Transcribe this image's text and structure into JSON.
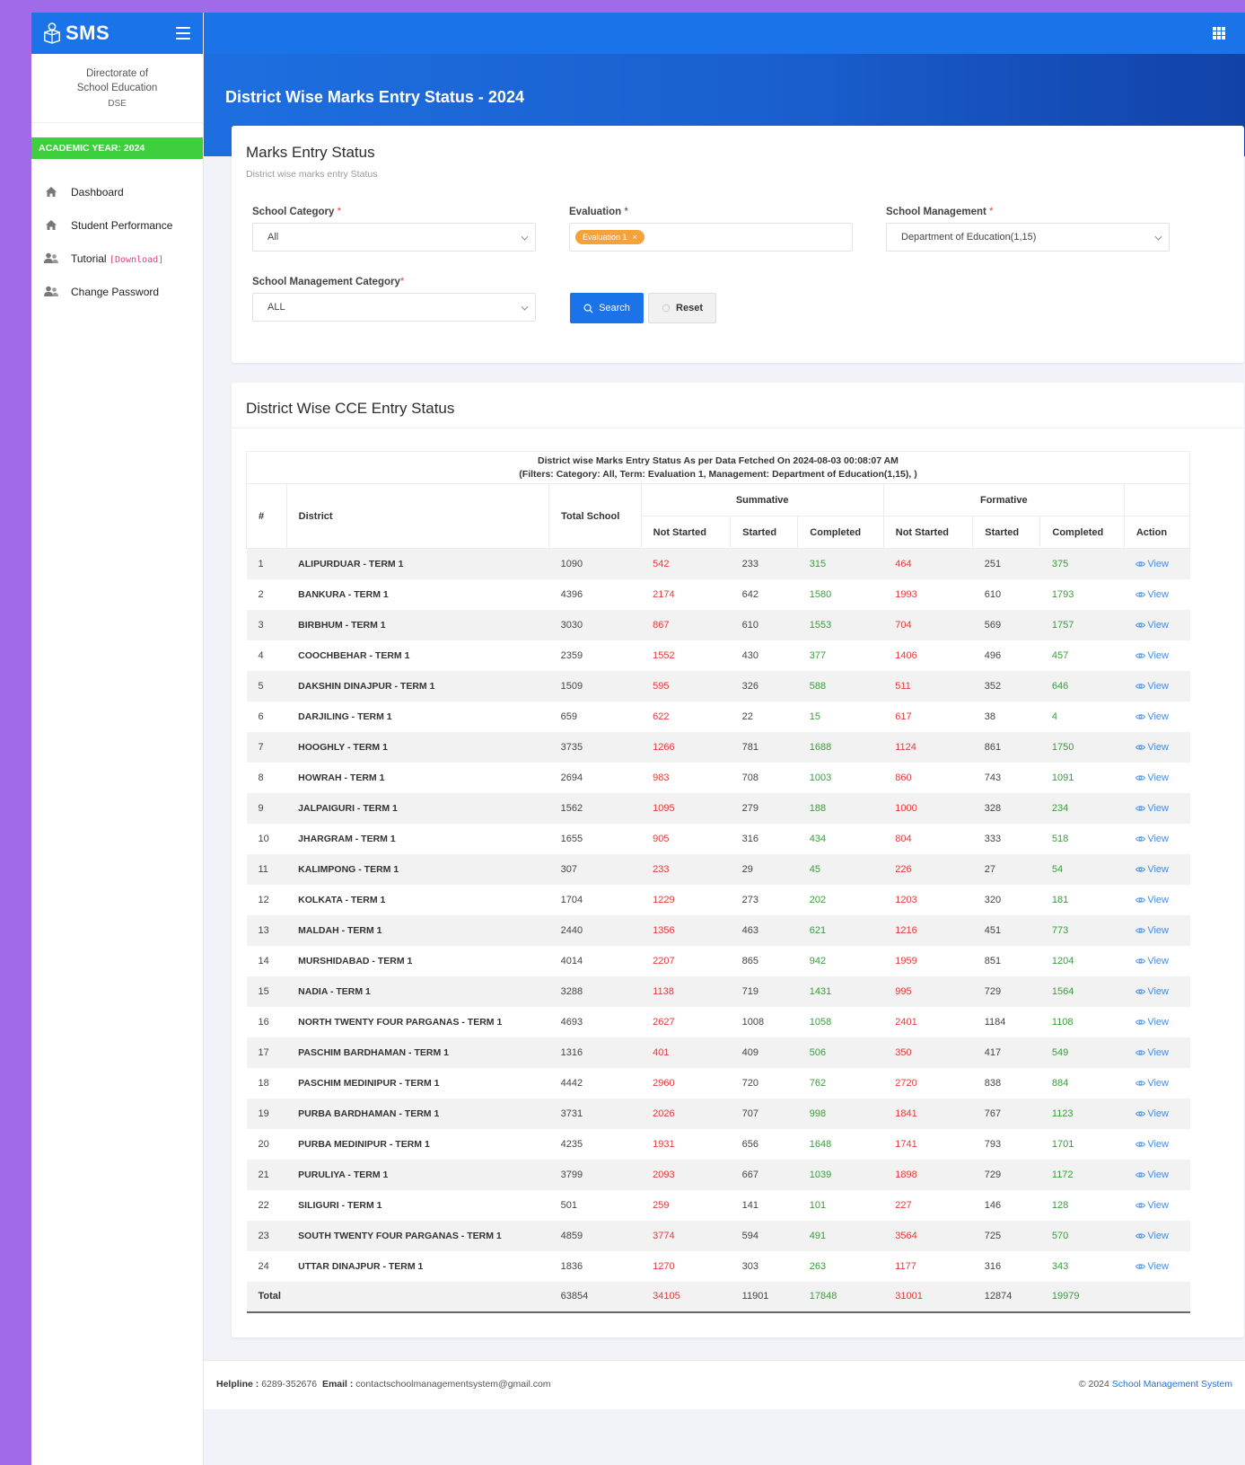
{
  "brand": {
    "name": "SMS"
  },
  "org": {
    "line1": "Directorate of",
    "line2": "School Education",
    "abbr": "DSE"
  },
  "academic_year": "ACADEMIC YEAR: 2024",
  "nav": [
    {
      "label": "Dashboard",
      "icon": "home-icon"
    },
    {
      "label": "Student Performance",
      "icon": "home-icon"
    },
    {
      "label": "Tutorial",
      "extra": "[Download]",
      "icon": "users-icon"
    },
    {
      "label": "Change Password",
      "icon": "users-icon"
    }
  ],
  "page_title": "District Wise Marks Entry Status - 2024",
  "filters": {
    "title": "Marks Entry Status",
    "subtitle": "District wise marks entry Status",
    "school_category": {
      "label": "School Category",
      "value": "All"
    },
    "evaluation": {
      "label": "Evaluation",
      "tag": "Evaluation 1"
    },
    "school_management": {
      "label": "School Management",
      "value": "Department of Education(1,15)"
    },
    "school_management_category": {
      "label": "School Management Category",
      "value": "ALL"
    },
    "search_label": "Search",
    "reset_label": "Reset"
  },
  "table_card": {
    "title": "District Wise CCE Entry Status",
    "caption_line1": "District wise Marks Entry Status As per Data Fetched On 2024-08-03 00:08:07 AM",
    "caption_line2": "(Filters: Category: All, Term: Evaluation 1, Management: Department of Education(1,15), )",
    "headers": {
      "num": "#",
      "district": "District",
      "total": "Total School",
      "summative": "Summative",
      "formative": "Formative",
      "not_started": "Not Started",
      "started": "Started",
      "completed": "Completed",
      "action": "Action"
    },
    "view_label": "View",
    "rows": [
      [
        "1",
        "ALIPURDUAR - TERM 1",
        "1090",
        "542",
        "233",
        "315",
        "464",
        "251",
        "375"
      ],
      [
        "2",
        "BANKURA - TERM 1",
        "4396",
        "2174",
        "642",
        "1580",
        "1993",
        "610",
        "1793"
      ],
      [
        "3",
        "BIRBHUM - TERM 1",
        "3030",
        "867",
        "610",
        "1553",
        "704",
        "569",
        "1757"
      ],
      [
        "4",
        "COOCHBEHAR - TERM 1",
        "2359",
        "1552",
        "430",
        "377",
        "1406",
        "496",
        "457"
      ],
      [
        "5",
        "DAKSHIN DINAJPUR - TERM 1",
        "1509",
        "595",
        "326",
        "588",
        "511",
        "352",
        "646"
      ],
      [
        "6",
        "DARJILING - TERM 1",
        "659",
        "622",
        "22",
        "15",
        "617",
        "38",
        "4"
      ],
      [
        "7",
        "HOOGHLY - TERM 1",
        "3735",
        "1266",
        "781",
        "1688",
        "1124",
        "861",
        "1750"
      ],
      [
        "8",
        "HOWRAH - TERM 1",
        "2694",
        "983",
        "708",
        "1003",
        "860",
        "743",
        "1091"
      ],
      [
        "9",
        "JALPAIGURI - TERM 1",
        "1562",
        "1095",
        "279",
        "188",
        "1000",
        "328",
        "234"
      ],
      [
        "10",
        "JHARGRAM - TERM 1",
        "1655",
        "905",
        "316",
        "434",
        "804",
        "333",
        "518"
      ],
      [
        "11",
        "KALIMPONG - TERM 1",
        "307",
        "233",
        "29",
        "45",
        "226",
        "27",
        "54"
      ],
      [
        "12",
        "KOLKATA - TERM 1",
        "1704",
        "1229",
        "273",
        "202",
        "1203",
        "320",
        "181"
      ],
      [
        "13",
        "MALDAH - TERM 1",
        "2440",
        "1356",
        "463",
        "621",
        "1216",
        "451",
        "773"
      ],
      [
        "14",
        "MURSHIDABAD - TERM 1",
        "4014",
        "2207",
        "865",
        "942",
        "1959",
        "851",
        "1204"
      ],
      [
        "15",
        "NADIA - TERM 1",
        "3288",
        "1138",
        "719",
        "1431",
        "995",
        "729",
        "1564"
      ],
      [
        "16",
        "NORTH TWENTY FOUR PARGANAS - TERM 1",
        "4693",
        "2627",
        "1008",
        "1058",
        "2401",
        "1184",
        "1108"
      ],
      [
        "17",
        "PASCHIM BARDHAMAN - TERM 1",
        "1316",
        "401",
        "409",
        "506",
        "350",
        "417",
        "549"
      ],
      [
        "18",
        "PASCHIM MEDINIPUR - TERM 1",
        "4442",
        "2960",
        "720",
        "762",
        "2720",
        "838",
        "884"
      ],
      [
        "19",
        "PURBA BARDHAMAN - TERM 1",
        "3731",
        "2026",
        "707",
        "998",
        "1841",
        "767",
        "1123"
      ],
      [
        "20",
        "PURBA MEDINIPUR - TERM 1",
        "4235",
        "1931",
        "656",
        "1648",
        "1741",
        "793",
        "1701"
      ],
      [
        "21",
        "PURULIYA - TERM 1",
        "3799",
        "2093",
        "667",
        "1039",
        "1898",
        "729",
        "1172"
      ],
      [
        "22",
        "SILIGURI - TERM 1",
        "501",
        "259",
        "141",
        "101",
        "227",
        "146",
        "128"
      ],
      [
        "23",
        "SOUTH TWENTY FOUR PARGANAS - TERM 1",
        "4859",
        "3774",
        "594",
        "491",
        "3564",
        "725",
        "570"
      ],
      [
        "24",
        "UTTAR DINAJPUR - TERM 1",
        "1836",
        "1270",
        "303",
        "263",
        "1177",
        "316",
        "343"
      ]
    ],
    "total": [
      "Total",
      "",
      "63854",
      "34105",
      "11901",
      "17848",
      "31001",
      "12874",
      "19979"
    ]
  },
  "footer": {
    "helpline_label": "Helpline :",
    "helpline": "6289-352676",
    "email_label": "Email :",
    "email": "contactschoolmanagementsystem@gmail.com",
    "copyright": "© 2024",
    "link": "School Management System"
  },
  "colors": {
    "primary": "#1a73e8",
    "academic": "#3fce3d",
    "red": "#e33b3b",
    "green": "#3a9c3a",
    "tag": "#f6a23a"
  }
}
